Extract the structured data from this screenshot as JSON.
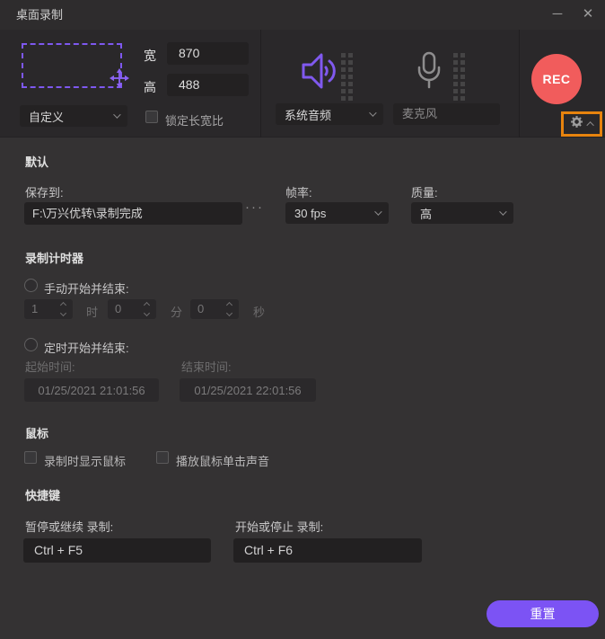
{
  "window": {
    "title": "桌面录制",
    "minimize_glyph": "─",
    "close_glyph": "✕"
  },
  "capture": {
    "width_label": "宽",
    "width_value": "870",
    "height_label": "高",
    "height_value": "488",
    "mode_selected": "自定义",
    "lock_aspect_label": "锁定长宽比",
    "lock_aspect_checked": false
  },
  "audio": {
    "system_audio_selected": "系统音频",
    "microphone_value": "麦克风"
  },
  "record": {
    "rec_label": "REC"
  },
  "defaults": {
    "header": "默认",
    "save_to_label": "保存到:",
    "save_path": "F:\\万兴优转\\录制完成",
    "browse_glyph": "···",
    "framerate_label": "帧率:",
    "framerate_selected": "30 fps",
    "quality_label": "质量:",
    "quality_selected": "高"
  },
  "timer": {
    "header": "录制计时器",
    "manual_label": "手动开始并结束:",
    "manual_checked": false,
    "hours_value": "1",
    "hours_unit": "时",
    "minutes_value": "0",
    "minutes_unit": "分",
    "seconds_value": "0",
    "seconds_unit": "秒",
    "scheduled_label": "定时开始并结束:",
    "scheduled_checked": false,
    "start_time_label": "起始时间:",
    "start_time_value": "01/25/2021 21:01:56",
    "end_time_label": "结束时间:",
    "end_time_value": "01/25/2021 22:01:56"
  },
  "mouse": {
    "header": "鼠标",
    "show_cursor_label": "录制时显示鼠标",
    "show_cursor_checked": false,
    "click_sound_label": "播放鼠标单击声音",
    "click_sound_checked": false
  },
  "hotkeys": {
    "header": "快捷键",
    "pause_resume_label": "暂停或继续 录制:",
    "pause_resume_value": "Ctrl + F5",
    "start_stop_label": "开始或停止 录制:",
    "start_stop_value": "Ctrl + F6"
  },
  "footer": {
    "reset_label": "重置"
  },
  "colors": {
    "accent_purple": "#7e58f0",
    "rec_red": "#f15c5c",
    "highlight_orange": "#e7830e",
    "reset_button_purple": "#7c53f4",
    "panel_dark": "#2a282a",
    "body_gray": "#343233"
  }
}
